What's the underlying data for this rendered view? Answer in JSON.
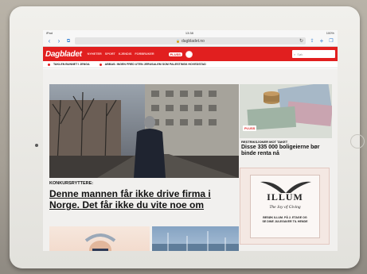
{
  "status_bar": {
    "left": "iPad",
    "time": "13:38",
    "right": "100%"
  },
  "browser": {
    "url": "dagbladet.no",
    "back_icon": "chevron-left-icon",
    "forward_icon": "chevron-right-icon",
    "bookmarks_icon": "book-icon",
    "reload_icon": "reload-icon",
    "share_icon": "share-icon",
    "add_icon": "plus-icon",
    "tabs_icon": "tabs-icon"
  },
  "site": {
    "logo": "Dagbladet",
    "nav": [
      "NYHETER",
      "SPORT",
      "KJENDIS",
      "FORBRUKER"
    ],
    "plus_label": "PLUSS",
    "search_placeholder": "Søk",
    "ticker": [
      "TAKLEN BUNNET I JENGA",
      "ABBAS: INGEN FRED UTEN JERUSALEM SOM PALESTINSK HOVEDSTAD"
    ]
  },
  "lead": {
    "kicker": "KONKURSRYTTERE:",
    "headline": "Denne mannen får ikke drive firma i Norge. Det får ikke du vite noe om"
  },
  "side_story": {
    "badge": "PLUSS",
    "kicker": "RESTRIKSJONER MOT TAKET",
    "headline": "Disse 335 000 boligeierne bør binde renta nå"
  },
  "ad": {
    "logo": "ILLUM",
    "tagline": "The Joy of Giving",
    "cta_line1": "BESØK ILLUM. PÅ 2. ETAGE OG",
    "cta_line2": "SE DINE JULEGAVER TIL HENDE"
  },
  "colors": {
    "brand_red": "#e11f1f",
    "link_blue": "#2b7cd3"
  }
}
